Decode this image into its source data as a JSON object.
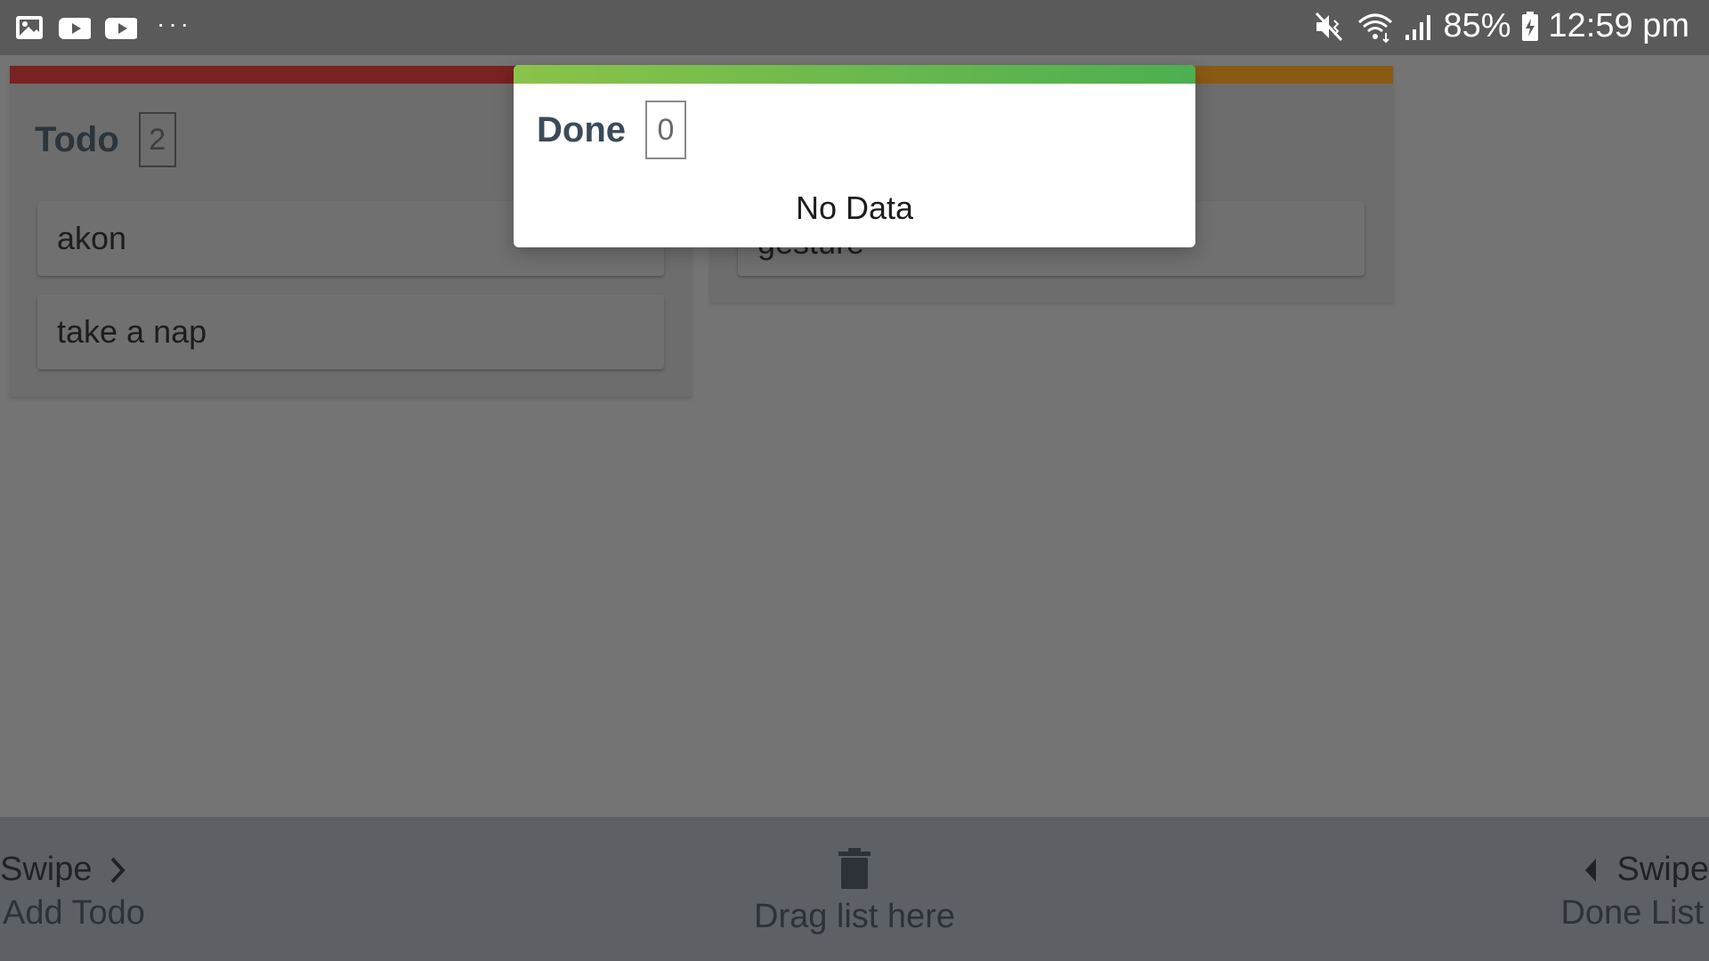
{
  "status_bar": {
    "battery_percent": "85%",
    "time": "12:59 pm",
    "left_icons": [
      "gallery-icon",
      "youtube-icon",
      "youtube-icon"
    ],
    "more": "···",
    "right_icons": [
      "mute-icon",
      "wifi-icon",
      "signal-icon",
      "battery-icon"
    ]
  },
  "board": {
    "columns": [
      {
        "title": "Todo",
        "count": "2",
        "accent": "#a52a2a",
        "cards": [
          "akon",
          "take a nap"
        ]
      },
      {
        "title": "",
        "count": "",
        "accent": "#a86b10",
        "cards": [
          "gesture"
        ]
      }
    ]
  },
  "popup": {
    "title": "Done",
    "count": "0",
    "empty_text": "No Data",
    "accent": "#6fbf4a"
  },
  "bottom": {
    "left": {
      "swipe": "Swipe",
      "label": "Add Todo"
    },
    "center": {
      "label": "Drag list here",
      "icon": "trash-icon"
    },
    "right": {
      "swipe": "Swipe",
      "label": "Done List"
    }
  }
}
